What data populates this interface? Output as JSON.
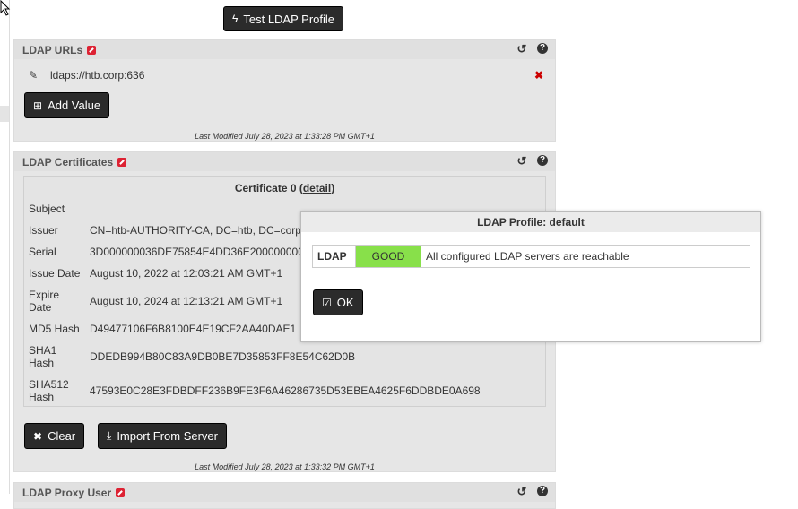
{
  "toolbar": {
    "test_ldap_profile_label": "Test LDAP Profile"
  },
  "ldap_urls": {
    "title": "LDAP URLs",
    "values": [
      "ldaps://htb.corp:636"
    ],
    "add_value_label": "Add Value",
    "last_modified": "Last Modified July 28, 2023 at 1:33:28 PM GMT+1"
  },
  "ldap_certificates": {
    "title": "LDAP Certificates",
    "cert_heading": "Certificate 0 (",
    "cert_detail_link": "detail",
    "cert_heading_end": ")",
    "fields": [
      {
        "label": "Subject",
        "value": ""
      },
      {
        "label": "Issuer",
        "value": "CN=htb-AUTHORITY-CA, DC=htb, DC=corp"
      },
      {
        "label": "Serial",
        "value": "3D000000036DE75854E4DD36E200000000"
      },
      {
        "label": "Issue Date",
        "value": "August 10, 2022 at 12:03:21 AM GMT+1"
      },
      {
        "label": "Expire Date",
        "value": "August 10, 2024 at 12:13:21 AM GMT+1"
      },
      {
        "label": "MD5 Hash",
        "value": "D49477106F6B8100E4E19CF2AA40DAE1"
      },
      {
        "label": "SHA1 Hash",
        "value": "DDEDB994B80C83A9DB0BE7D35853FF8E54C62D0B"
      },
      {
        "label": "SHA512 Hash",
        "value": "47593E0C28E3FDBDFF236B9FE3F6A46286735D53EBEA4625F6DDBDE0A698"
      }
    ],
    "clear_label": "Clear",
    "import_label": "Import From Server",
    "last_modified": "Last Modified July 28, 2023 at 1:33:32 PM GMT+1"
  },
  "ldap_proxy_user": {
    "title": "LDAP Proxy User"
  },
  "modal": {
    "title": "LDAP Profile: default",
    "row_label": "LDAP",
    "status": "GOOD",
    "message": "All configured LDAP servers are reachable",
    "ok_label": "OK",
    "status_color": "#88e04a"
  }
}
